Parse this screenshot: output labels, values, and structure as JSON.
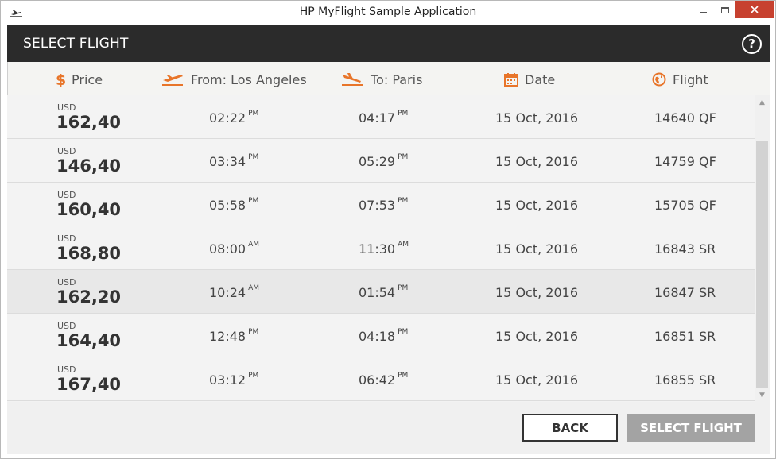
{
  "window": {
    "title": "HP MyFlight Sample Application",
    "close_color": "#c7412f"
  },
  "header": {
    "title": "SELECT FLIGHT",
    "help_label": "?"
  },
  "columns": {
    "price": "Price",
    "from": "From: Los Angeles",
    "to": "To: Paris",
    "date": "Date",
    "flight": "Flight"
  },
  "accent_color": "#e8752a",
  "flights": [
    {
      "currency": "USD",
      "price": "162,40",
      "dep_time": "02:22",
      "dep_ampm": "PM",
      "arr_time": "04:17",
      "arr_ampm": "PM",
      "date": "15 Oct, 2016",
      "flight": "14640 QF"
    },
    {
      "currency": "USD",
      "price": "146,40",
      "dep_time": "03:34",
      "dep_ampm": "PM",
      "arr_time": "05:29",
      "arr_ampm": "PM",
      "date": "15 Oct, 2016",
      "flight": "14759 QF"
    },
    {
      "currency": "USD",
      "price": "160,40",
      "dep_time": "05:58",
      "dep_ampm": "PM",
      "arr_time": "07:53",
      "arr_ampm": "PM",
      "date": "15 Oct, 2016",
      "flight": "15705 QF"
    },
    {
      "currency": "USD",
      "price": "168,80",
      "dep_time": "08:00",
      "dep_ampm": "AM",
      "arr_time": "11:30",
      "arr_ampm": "AM",
      "date": "15 Oct, 2016",
      "flight": "16843 SR"
    },
    {
      "currency": "USD",
      "price": "162,20",
      "dep_time": "10:24",
      "dep_ampm": "AM",
      "arr_time": "01:54",
      "arr_ampm": "PM",
      "date": "15 Oct, 2016",
      "flight": "16847 SR"
    },
    {
      "currency": "USD",
      "price": "164,40",
      "dep_time": "12:48",
      "dep_ampm": "PM",
      "arr_time": "04:18",
      "arr_ampm": "PM",
      "date": "15 Oct, 2016",
      "flight": "16851 SR"
    },
    {
      "currency": "USD",
      "price": "167,40",
      "dep_time": "03:12",
      "dep_ampm": "PM",
      "arr_time": "06:42",
      "arr_ampm": "PM",
      "date": "15 Oct, 2016",
      "flight": "16855 SR"
    }
  ],
  "selected_row": 4,
  "buttons": {
    "back": "BACK",
    "select": "SELECT FLIGHT"
  }
}
